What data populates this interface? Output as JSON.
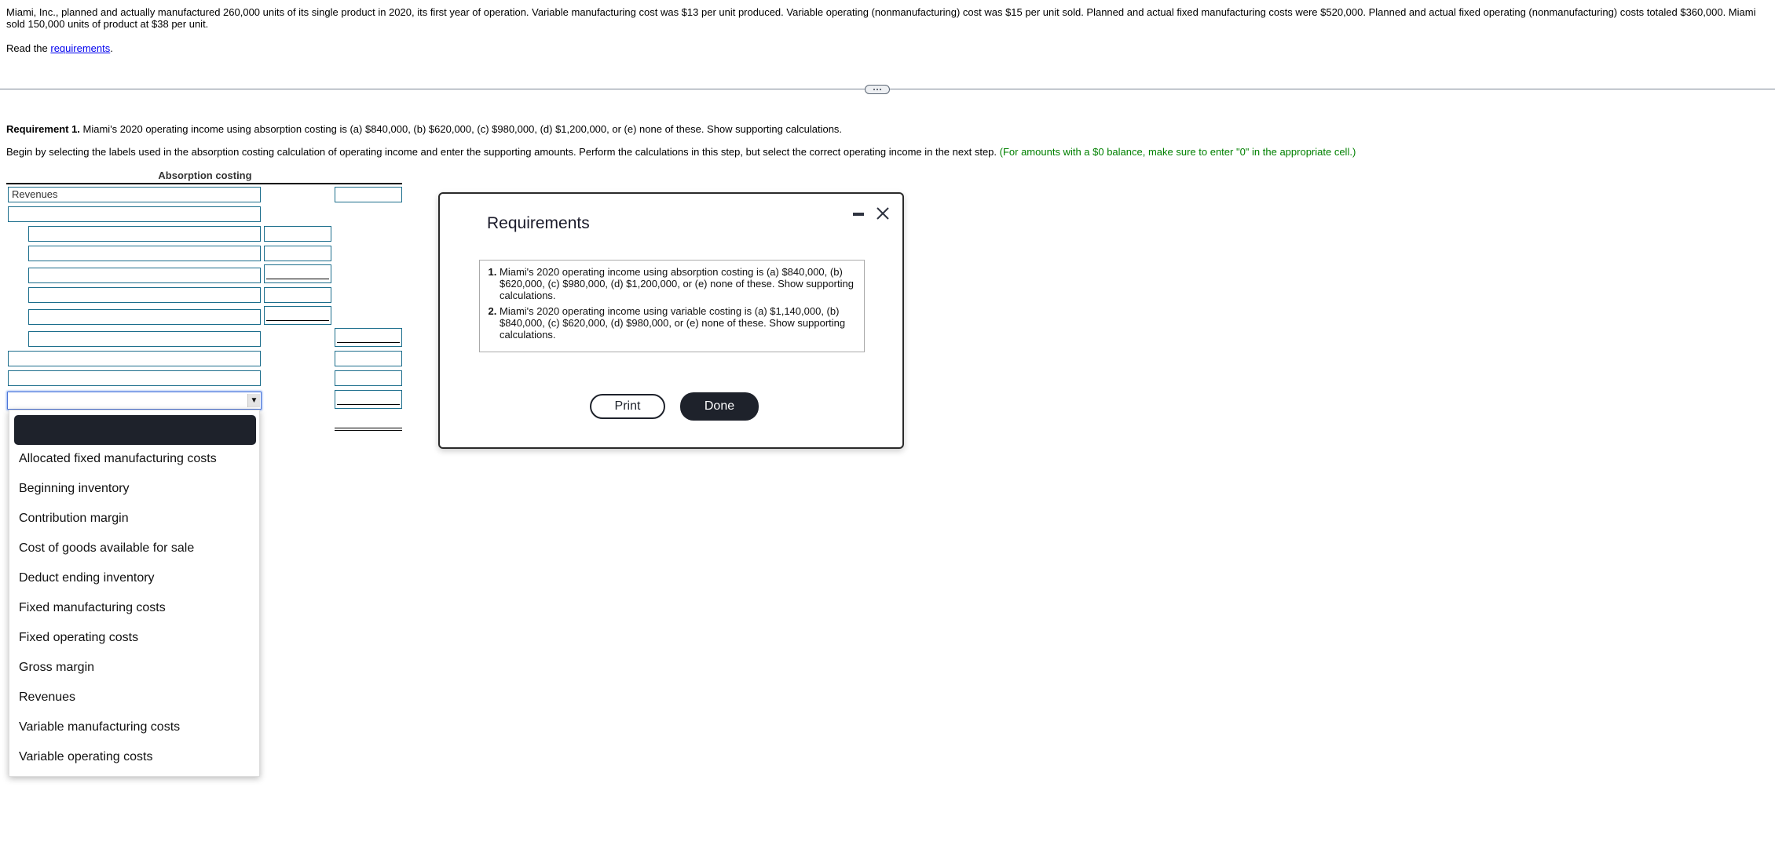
{
  "problem": {
    "text": "Miami, Inc., planned and actually manufactured 260,000 units of its single product in 2020, its first year of operation. Variable manufacturing cost was $13 per unit produced. Variable operating (nonmanufacturing) cost was $15 per unit sold. Planned and actual fixed manufacturing costs were $520,000. Planned and actual fixed operating (nonmanufacturing) costs totaled $360,000. Miami sold 150,000 units of product at $38 per unit.",
    "read_prefix": "Read the ",
    "read_link": "requirements",
    "read_suffix": "."
  },
  "requirement1": {
    "label": "Requirement 1.",
    "text": " Miami's 2020 operating income using absorption costing is (a) $840,000, (b) $620,000, (c) $980,000, (d) $1,200,000, or (e) none of these. Show supporting calculations."
  },
  "instructions": {
    "text": "Begin by selecting the labels used in the absorption costing calculation of operating income and enter the supporting amounts. Perform the calculations in this step, but select the correct operating income in the next step. ",
    "hint": "(For amounts with a $0 balance, make sure to enter \"0\" in the appropriate cell.)",
    "hint_color": "#008000"
  },
  "table": {
    "title": "Absorption costing",
    "first_label": "Revenues"
  },
  "dropdown": {
    "selected": "",
    "options": [
      "Allocated fixed manufacturing costs",
      "Beginning inventory",
      "Contribution margin",
      "Cost of goods available for sale",
      "Deduct ending inventory",
      "Fixed manufacturing costs",
      "Fixed operating costs",
      "Gross margin",
      "Revenues",
      "Variable manufacturing costs",
      "Variable operating costs"
    ]
  },
  "modal": {
    "title": "Requirements",
    "items": [
      "Miami's 2020 operating income using absorption costing is (a) $840,000, (b) $620,000, (c) $980,000, (d) $1,200,000, or (e) none of these. Show supporting calculations.",
      "Miami's 2020 operating income using variable costing is (a) $1,140,000, (b) $840,000, (c) $620,000, (d) $980,000, or (e) none of these. Show supporting calculations."
    ],
    "print_label": "Print",
    "done_label": "Done",
    "minimize_icon": "minimize-icon",
    "close_icon": "close-icon"
  },
  "colors": {
    "input_border": "#1c6e8c",
    "dark_button": "#1e222b",
    "link": "#0000ee"
  }
}
